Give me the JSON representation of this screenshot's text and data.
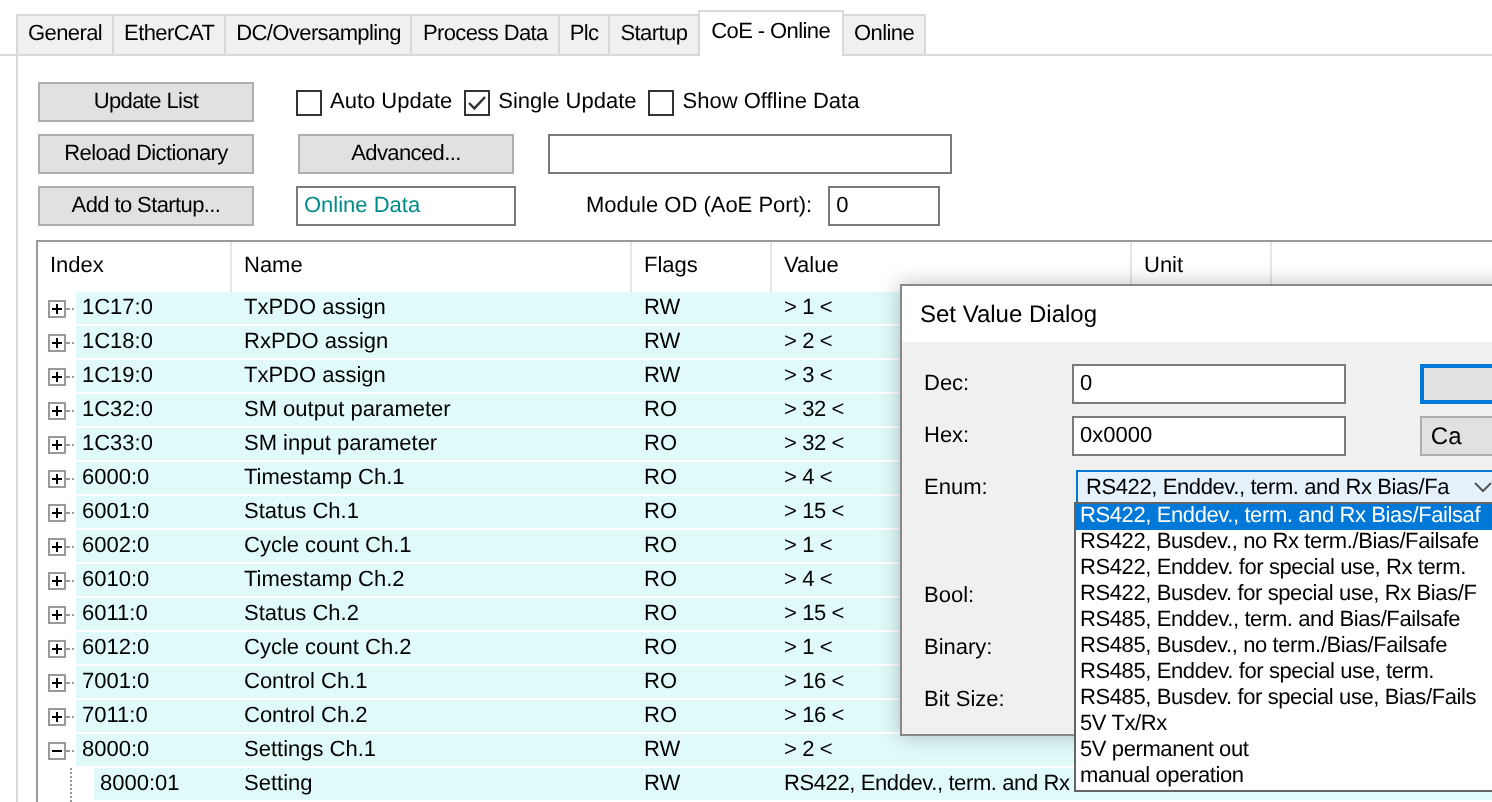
{
  "tabs": [
    {
      "label": "General",
      "selected": false
    },
    {
      "label": "EtherCAT",
      "selected": false
    },
    {
      "label": "DC/Oversampling",
      "selected": false
    },
    {
      "label": "Process Data",
      "selected": false
    },
    {
      "label": "Plc",
      "selected": false
    },
    {
      "label": "Startup",
      "selected": false
    },
    {
      "label": "CoE - Online",
      "selected": true
    },
    {
      "label": "Online",
      "selected": false
    }
  ],
  "buttons": [
    "Update List",
    "Reload Dictionary",
    "Add to Startup..."
  ],
  "checkboxes": [
    {
      "label": "Auto Update",
      "checked": false
    },
    {
      "label": "Single Update",
      "checked": true
    },
    {
      "label": "Show Offline Data",
      "checked": false
    }
  ],
  "advanced_button": "Advanced...",
  "online_data": "Online Data",
  "module_od": {
    "label": "Module OD (AoE Port):",
    "value": "0"
  },
  "table": {
    "columns": [
      "Index",
      "Name",
      "Flags",
      "Value",
      "Unit"
    ],
    "rows": [
      {
        "index": "1C17:0",
        "name": "TxPDO assign",
        "flags": "RW",
        "value": "> 1 <",
        "expanded": false
      },
      {
        "index": "1C18:0",
        "name": "RxPDO assign",
        "flags": "RW",
        "value": "> 2 <",
        "expanded": false
      },
      {
        "index": "1C19:0",
        "name": "TxPDO assign",
        "flags": "RW",
        "value": "> 3 <",
        "expanded": false
      },
      {
        "index": "1C32:0",
        "name": "SM output parameter",
        "flags": "RO",
        "value": "> 32 <",
        "expanded": false
      },
      {
        "index": "1C33:0",
        "name": "SM input parameter",
        "flags": "RO",
        "value": "> 32 <",
        "expanded": false
      },
      {
        "index": "6000:0",
        "name": "Timestamp Ch.1",
        "flags": "RO",
        "value": "> 4 <",
        "expanded": false
      },
      {
        "index": "6001:0",
        "name": "Status Ch.1",
        "flags": "RO",
        "value": "> 15 <",
        "expanded": false
      },
      {
        "index": "6002:0",
        "name": "Cycle count Ch.1",
        "flags": "RO",
        "value": "> 1 <",
        "expanded": false
      },
      {
        "index": "6010:0",
        "name": "Timestamp Ch.2",
        "flags": "RO",
        "value": "> 4 <",
        "expanded": false
      },
      {
        "index": "6011:0",
        "name": "Status Ch.2",
        "flags": "RO",
        "value": "> 15 <",
        "expanded": false
      },
      {
        "index": "6012:0",
        "name": "Cycle count Ch.2",
        "flags": "RO",
        "value": "> 1 <",
        "expanded": false
      },
      {
        "index": "7001:0",
        "name": "Control Ch.1",
        "flags": "RO",
        "value": "> 16 <",
        "expanded": false
      },
      {
        "index": "7011:0",
        "name": "Control Ch.2",
        "flags": "RO",
        "value": "> 16 <",
        "expanded": false
      },
      {
        "index": "8000:0",
        "name": "Settings Ch.1",
        "flags": "RW",
        "value": "> 2 <",
        "expanded": true,
        "children": [
          {
            "index": "8000:01",
            "name": "Setting",
            "flags": "RW",
            "value": "RS422, Enddev., term. and Rx"
          }
        ]
      }
    ]
  },
  "dialog": {
    "title": "Set Value Dialog",
    "fields": [
      {
        "label": "Dec:",
        "value": "0"
      },
      {
        "label": "Hex:",
        "value": "0x0000"
      }
    ],
    "enum": {
      "label": "Enum:",
      "value": "RS422, Enddev., term. and Rx Bias/Fa",
      "options": [
        {
          "label": "RS422, Enddev., term. and Rx Bias/Failsaf",
          "selected": true
        },
        {
          "label": "RS422, Busdev., no Rx term./Bias/Failsafe",
          "selected": false
        },
        {
          "label": "RS422, Enddev. for special use, Rx term.",
          "selected": false
        },
        {
          "label": "RS422, Busdev. for special use, Rx Bias/F",
          "selected": false
        },
        {
          "label": "RS485, Enddev., term. and Bias/Failsafe",
          "selected": false
        },
        {
          "label": "RS485, Busdev., no term./Bias/Failsafe",
          "selected": false
        },
        {
          "label": "RS485, Enddev. for special use, term.",
          "selected": false
        },
        {
          "label": "RS485, Busdev. for special use, Bias/Fails",
          "selected": false
        },
        {
          "label": "5V Tx/Rx",
          "selected": false
        },
        {
          "label": "5V permanent out",
          "selected": false
        },
        {
          "label": "manual operation",
          "selected": false
        }
      ]
    },
    "labels": [
      "Bool:",
      "Binary:",
      "Bit Size:"
    ],
    "buttons": [
      {
        "default": true
      },
      {
        "label": "Ca",
        "default": false
      }
    ]
  }
}
